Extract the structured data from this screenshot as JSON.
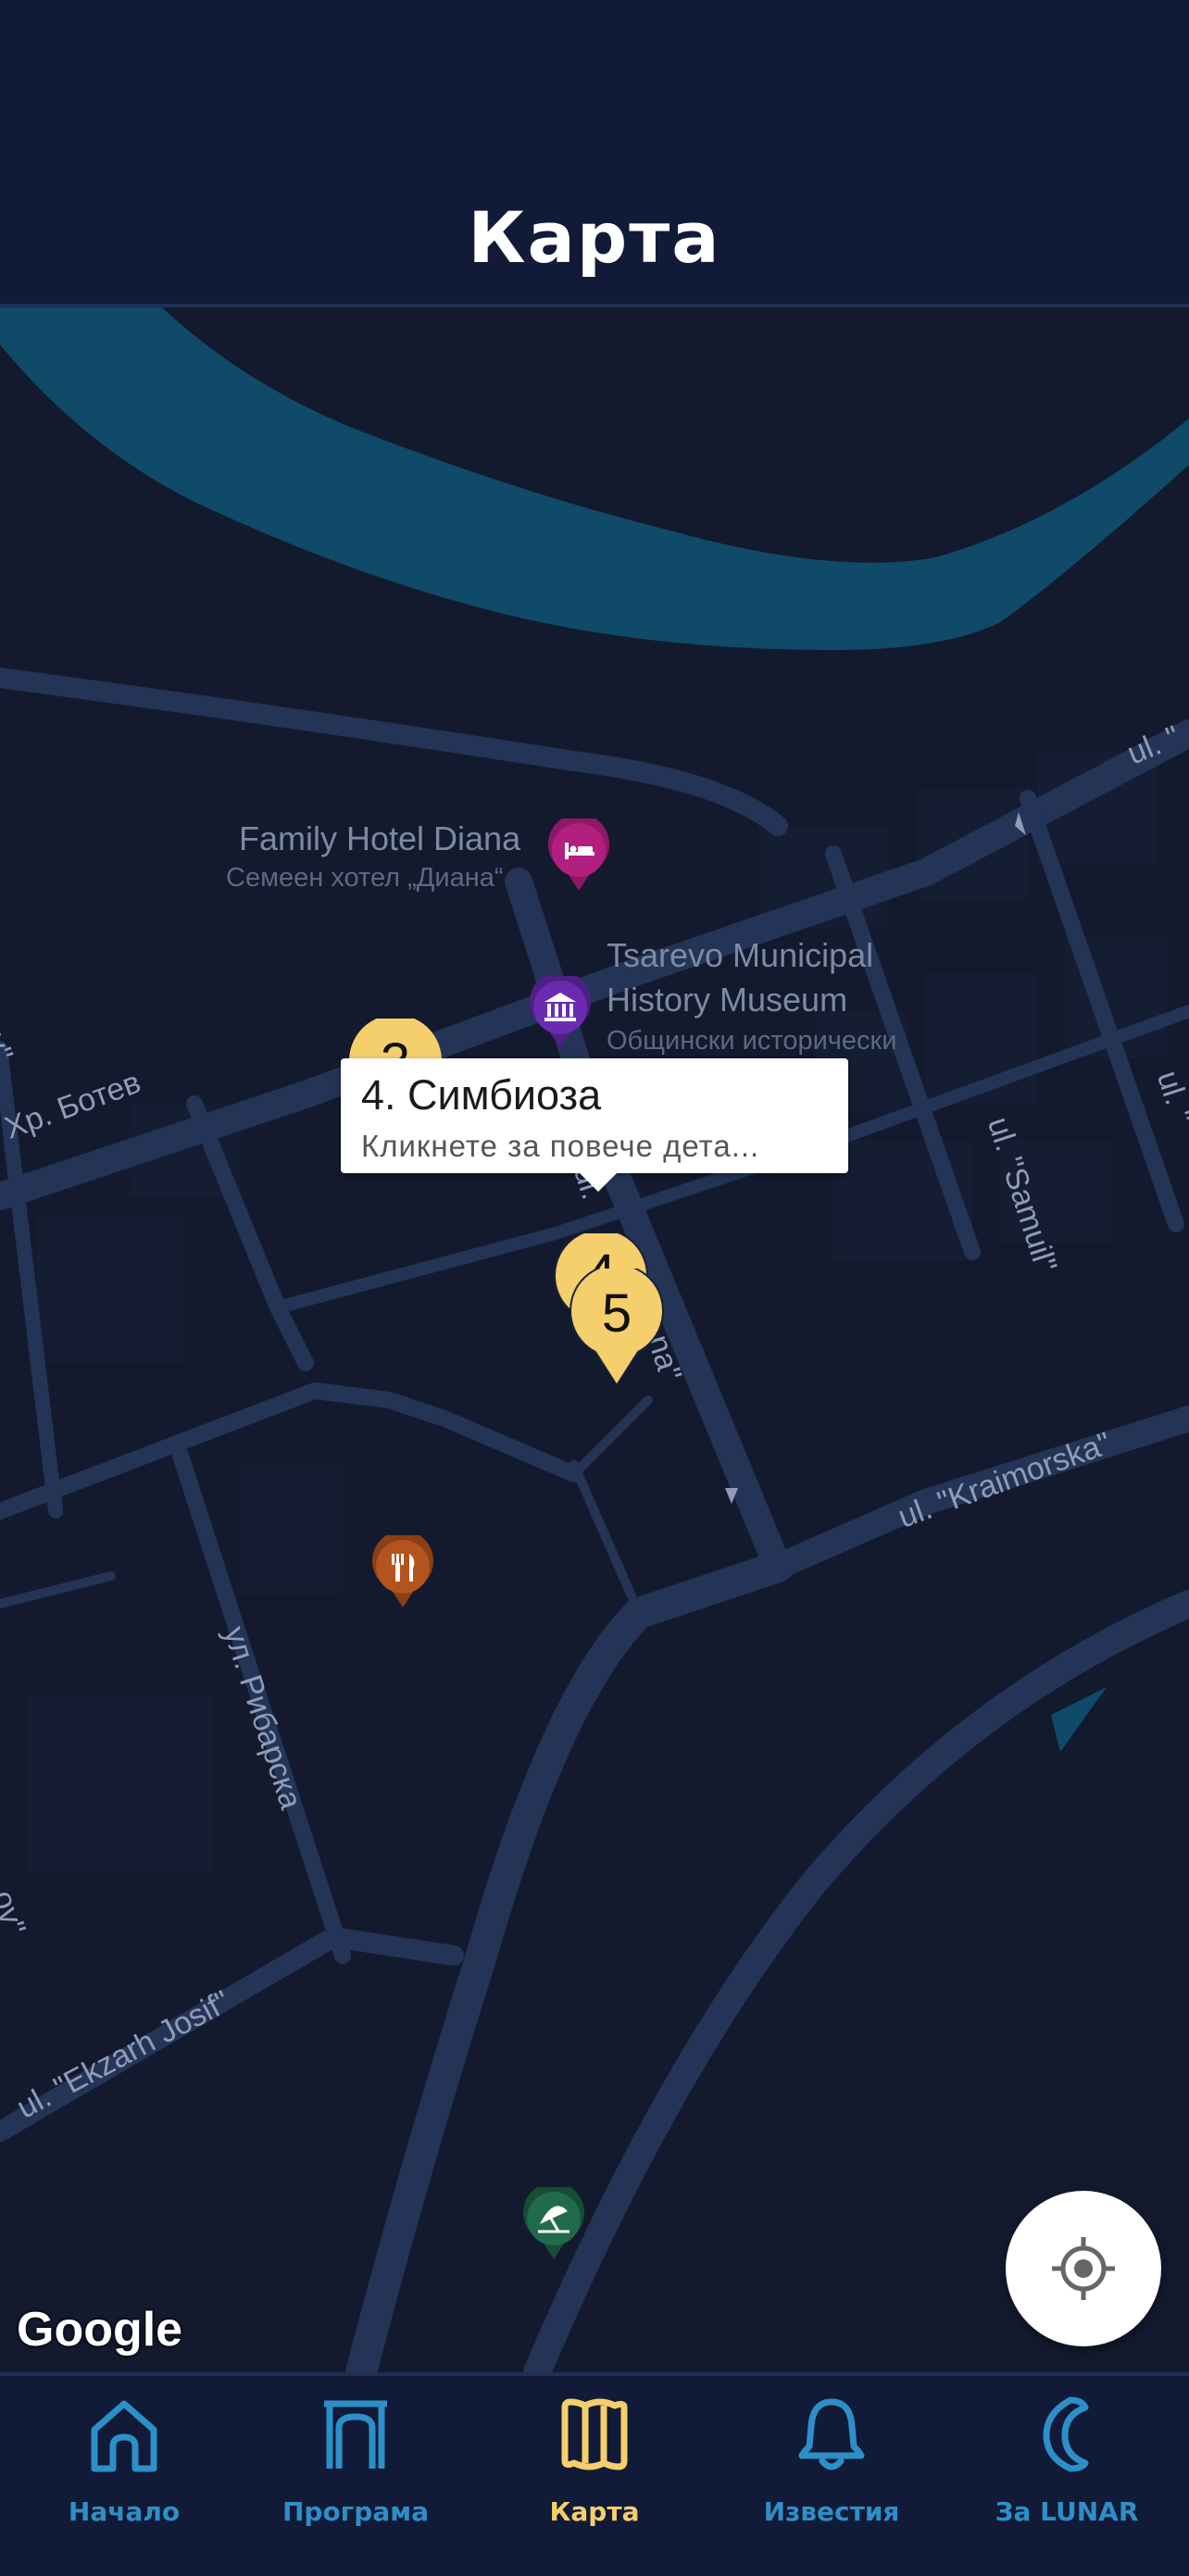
{
  "header": {
    "title": "Карта"
  },
  "map": {
    "pois": [
      {
        "name": "Family Hotel Diana",
        "subname": "Семеен хотел „Диана“",
        "icon": "hotel-icon",
        "color": "#b21f7f"
      },
      {
        "name": "Tsarevo Municipal\nHistory Museum",
        "subname": "Общински исторически",
        "icon": "museum-icon",
        "color": "#6a2bb0"
      },
      {
        "icon": "restaurant-icon",
        "color": "#b3541e"
      },
      {
        "icon": "park-icon",
        "color": "#1f6b4a"
      }
    ],
    "streets": [
      "Хр. Ботев",
      "Milev\"",
      "ul. \"Samuil\"",
      "ul. \"Kraimorska\"",
      "ул. Рибарска",
      "ul. \"Ekzarh Josif\"",
      "ul. \"",
      "ul. \"",
      "ul.",
      "na\"",
      "ov\""
    ],
    "markers": [
      "3",
      "4",
      "5"
    ],
    "callout": {
      "title": "4. Симбиоза",
      "subtitle": "Кликнете за повече дета..."
    },
    "attribution": "Google"
  },
  "locate_button": {
    "icon": "crosshair-icon"
  },
  "tabs": [
    {
      "label": "Начало",
      "icon": "home-icon",
      "active": false
    },
    {
      "label": "Програма",
      "icon": "stage-icon",
      "active": false
    },
    {
      "label": "Карта",
      "icon": "map-icon",
      "active": true
    },
    {
      "label": "Известия",
      "icon": "bell-icon",
      "active": false
    },
    {
      "label": "За LUNAR",
      "icon": "moon-icon",
      "active": false
    }
  ],
  "colors": {
    "accent": "#f5cf6c",
    "tab_inactive": "#2d8fc7",
    "header_bg": "#111b37",
    "map_bg": "#131a2e",
    "water": "#0f4a68",
    "road": "#243456"
  }
}
